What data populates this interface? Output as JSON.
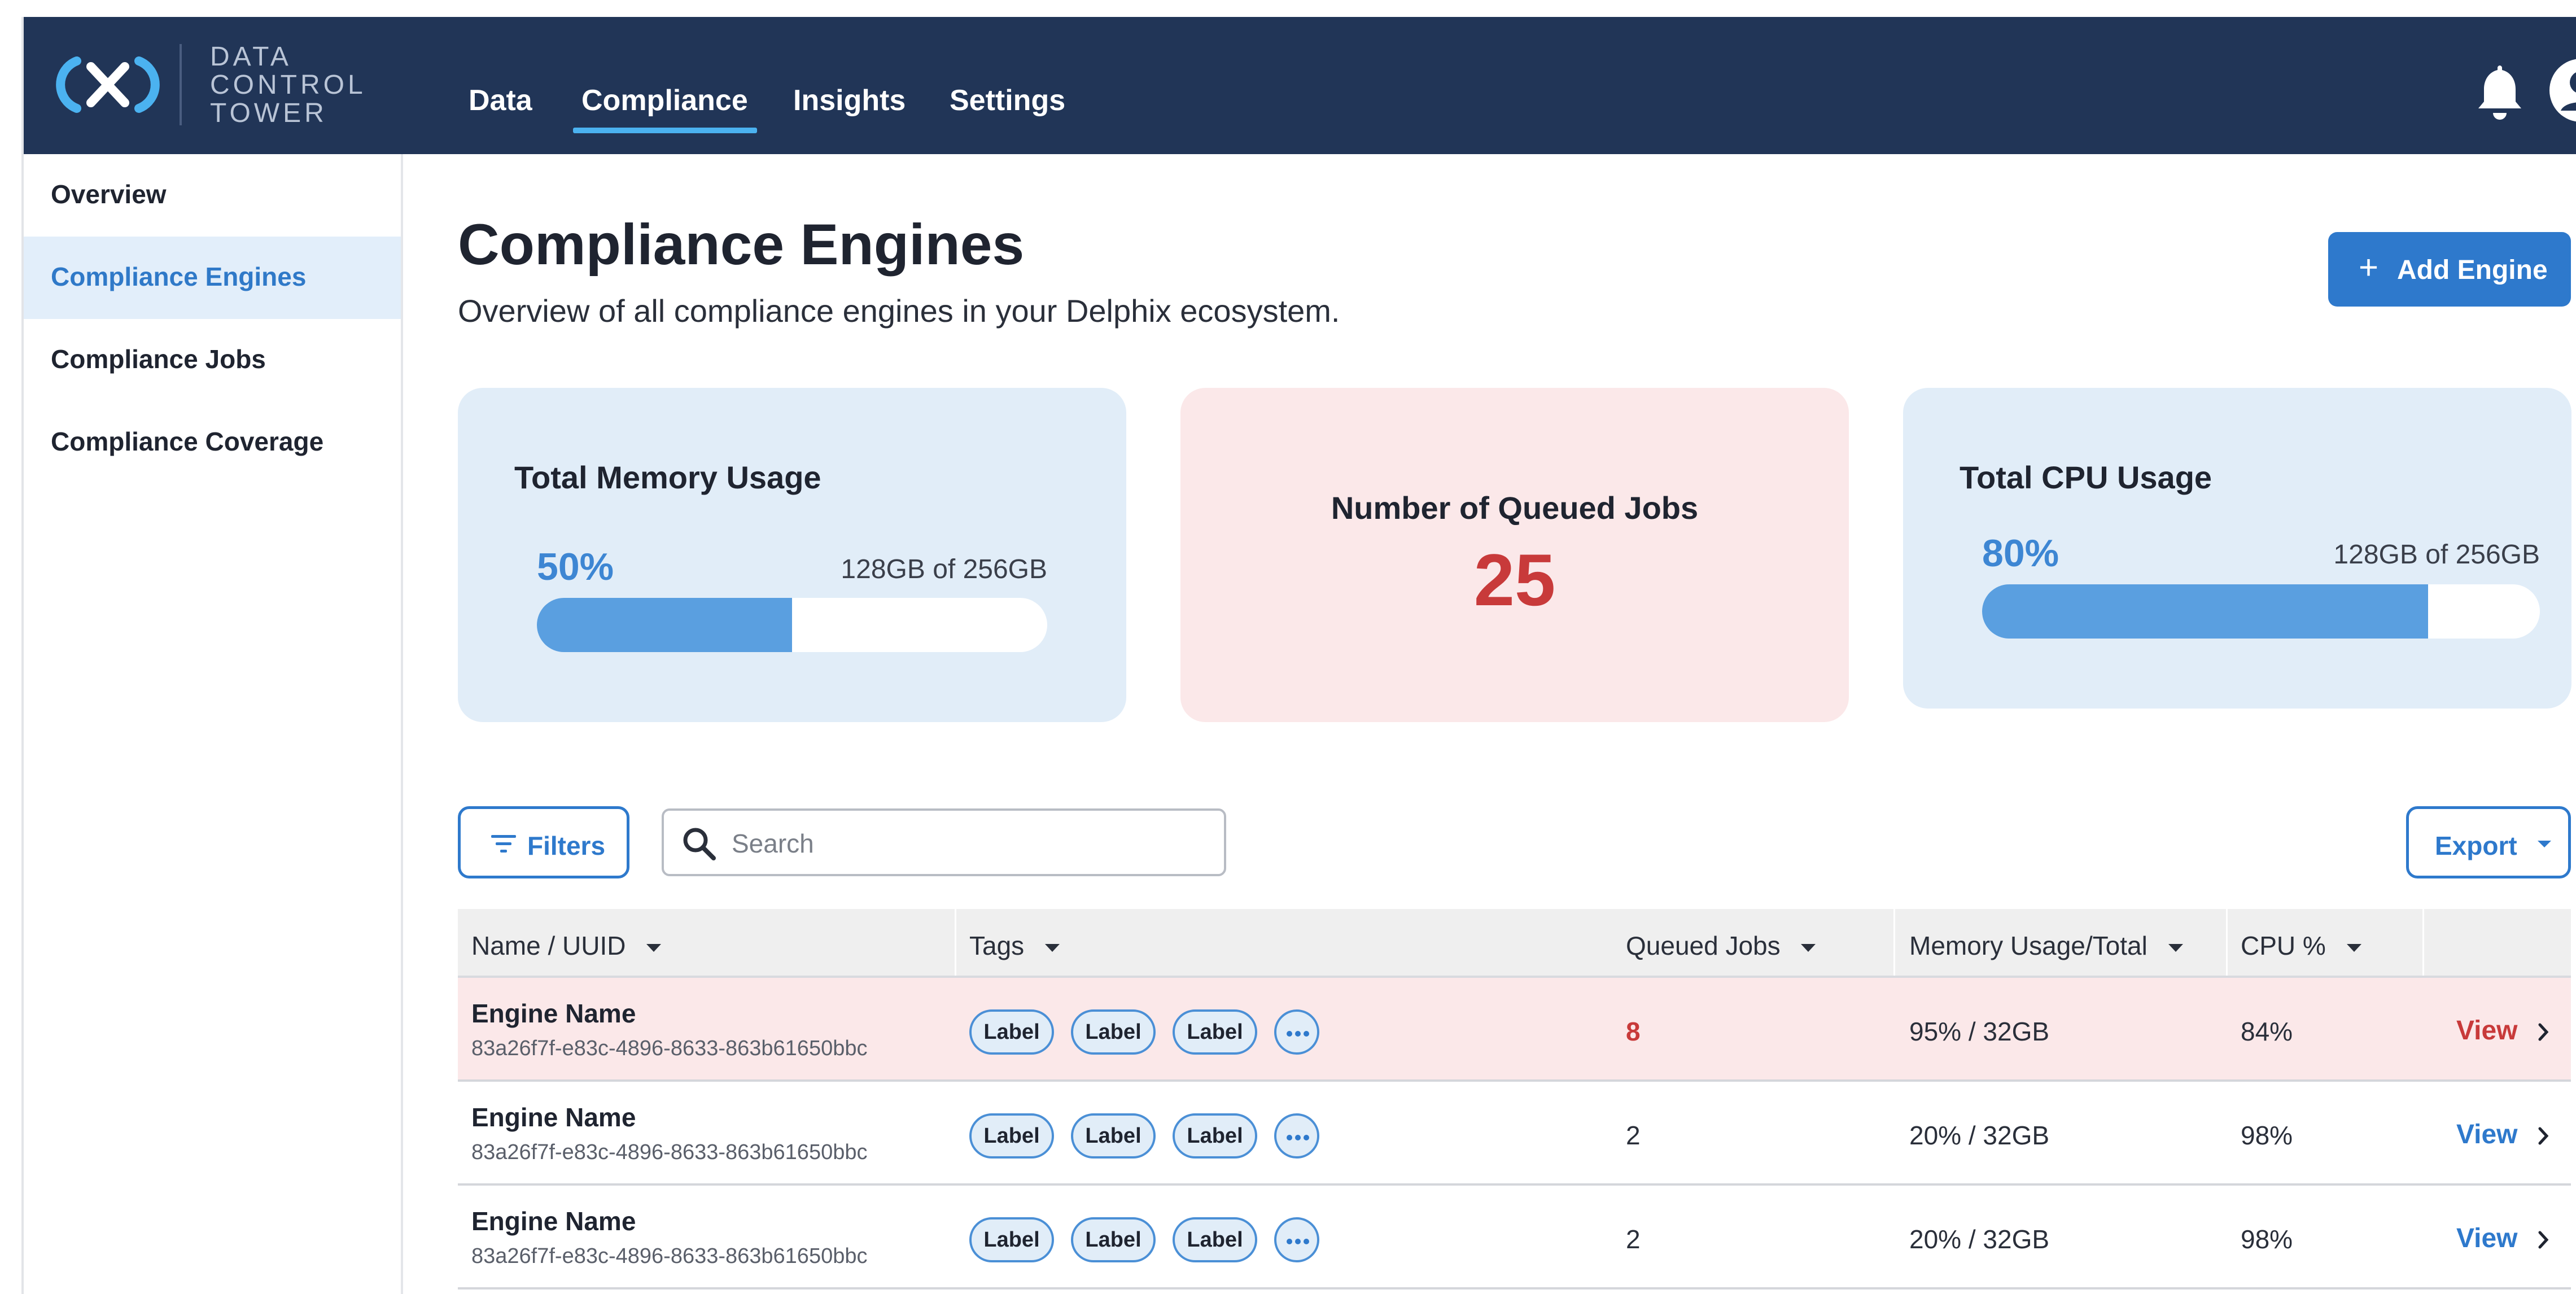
{
  "app": {
    "logo_lines": [
      "DATA",
      "CONTROL",
      "TOWER"
    ]
  },
  "nav": {
    "items": [
      {
        "label": "Data"
      },
      {
        "label": "Compliance",
        "active": true
      },
      {
        "label": "Insights"
      },
      {
        "label": "Settings"
      }
    ]
  },
  "sidebar": {
    "items": [
      {
        "label": "Overview"
      },
      {
        "label": "Compliance Engines",
        "active": true
      },
      {
        "label": "Compliance Jobs"
      },
      {
        "label": "Compliance Coverage"
      }
    ]
  },
  "page": {
    "title": "Compliance Engines",
    "subtitle": "Overview of all compliance engines in your Delphix ecosystem.",
    "add_button": "Add Engine"
  },
  "cards": {
    "memory": {
      "title": "Total Memory Usage",
      "percent_label": "50%",
      "percent": 50,
      "caption": "128GB of 256GB"
    },
    "queued": {
      "title": "Number of Queued Jobs",
      "value": "25"
    },
    "cpu": {
      "title": "Total CPU Usage",
      "percent_label": "80%",
      "percent": 80,
      "caption": "128GB of 256GB"
    }
  },
  "toolbar": {
    "filters_label": "Filters",
    "search_placeholder": "Search",
    "export_label": "Export"
  },
  "table": {
    "columns": [
      "Name / UUID",
      "Tags",
      "Queued Jobs",
      "Memory Usage/Total",
      "CPU %"
    ],
    "rows": [
      {
        "name": "Engine Name",
        "uuid": "83a26f7f-e83c-4896-8633-863b61650bbc",
        "tags": [
          "Label",
          "Label",
          "Label"
        ],
        "queued": "8",
        "memory": "95% / 32GB",
        "cpu": "84%",
        "action": "View",
        "alert": true
      },
      {
        "name": "Engine Name",
        "uuid": "83a26f7f-e83c-4896-8633-863b61650bbc",
        "tags": [
          "Label",
          "Label",
          "Label"
        ],
        "queued": "2",
        "memory": "20% / 32GB",
        "cpu": "98%",
        "action": "View",
        "alert": false
      },
      {
        "name": "Engine Name",
        "uuid": "83a26f7f-e83c-4896-8633-863b61650bbc",
        "tags": [
          "Label",
          "Label",
          "Label"
        ],
        "queued": "2",
        "memory": "20% / 32GB",
        "cpu": "98%",
        "action": "View",
        "alert": false
      }
    ]
  },
  "colors": {
    "header_bg": "#213557",
    "accent": "#2e79cc",
    "alert": "#c83a3a",
    "card_blue": "#e1edf8",
    "card_pink": "#fbe8e9"
  },
  "icons": [
    "logo-icon",
    "bell-icon",
    "user-icon",
    "plus-icon",
    "filter-icon",
    "search-icon",
    "caret-down-icon",
    "sort-caret-icon",
    "more-icon",
    "chevron-right-icon"
  ]
}
